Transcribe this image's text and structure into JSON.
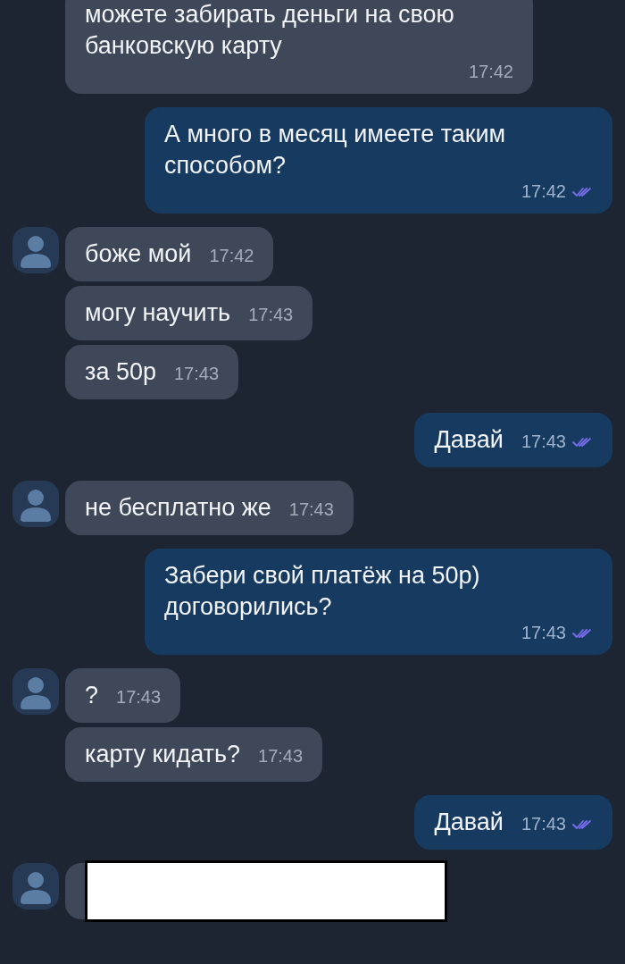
{
  "messages": [
    {
      "kind": "incoming",
      "avatar": false,
      "text": "можете забирать деньги на свою банковскую карту",
      "time": "17:42"
    },
    {
      "kind": "outgoing",
      "text": "А много в месяц имеете таким способом?",
      "time": "17:42",
      "read": true
    },
    {
      "kind": "incoming",
      "avatar": true,
      "text": "боже мой",
      "time": "17:42"
    },
    {
      "kind": "incoming",
      "avatar": false,
      "text": "могу научить",
      "time": "17:43"
    },
    {
      "kind": "incoming",
      "avatar": false,
      "text": "за 50р",
      "time": "17:43"
    },
    {
      "kind": "outgoing",
      "text": "Давай",
      "time": "17:43",
      "read": true
    },
    {
      "kind": "incoming",
      "avatar": true,
      "text": "не бесплатно же",
      "time": "17:43"
    },
    {
      "kind": "outgoing",
      "text": "Забери свой платёж на 50р) договорились?",
      "time": "17:43",
      "read": true
    },
    {
      "kind": "incoming",
      "avatar": true,
      "text": "?",
      "time": "17:43"
    },
    {
      "kind": "incoming",
      "avatar": false,
      "text": "карту кидать?",
      "time": "17:43"
    },
    {
      "kind": "outgoing",
      "text": "Давай",
      "time": "17:43",
      "read": true
    },
    {
      "kind": "redacted",
      "avatar": true
    }
  ]
}
